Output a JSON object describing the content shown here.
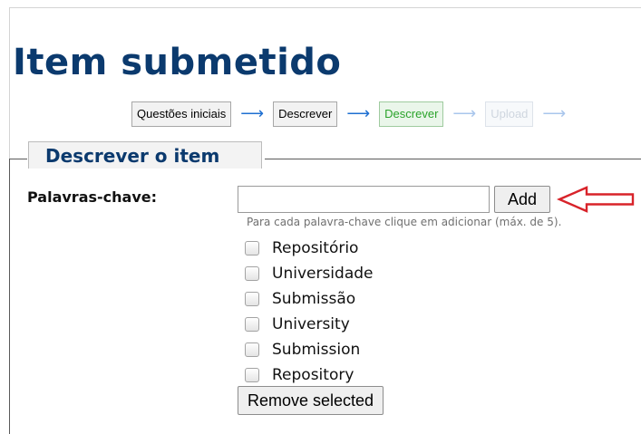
{
  "page": {
    "title": "Item submetido"
  },
  "steps": [
    {
      "label": "Questões iniciais",
      "state": "normal"
    },
    {
      "label": "Descrever",
      "state": "normal"
    },
    {
      "label": "Descrever",
      "state": "active"
    },
    {
      "label": "Upload",
      "state": "disabled"
    }
  ],
  "section": {
    "legend": "Descrever o item"
  },
  "keywords": {
    "label": "Palavras-chave:",
    "input_value": "",
    "add_label": "Add",
    "help": "Para cada palavra-chave clique em adicionar (máx. de 5).",
    "items": [
      "Repositório",
      "Universidade",
      "Submissão",
      "University",
      "Submission",
      "Repository"
    ],
    "remove_label": "Remove selected"
  },
  "colors": {
    "title": "#0b3a6e",
    "active_step": "#2ba32b",
    "arrow": "#1e6fd1",
    "annotation_arrow": "#d8232a"
  }
}
